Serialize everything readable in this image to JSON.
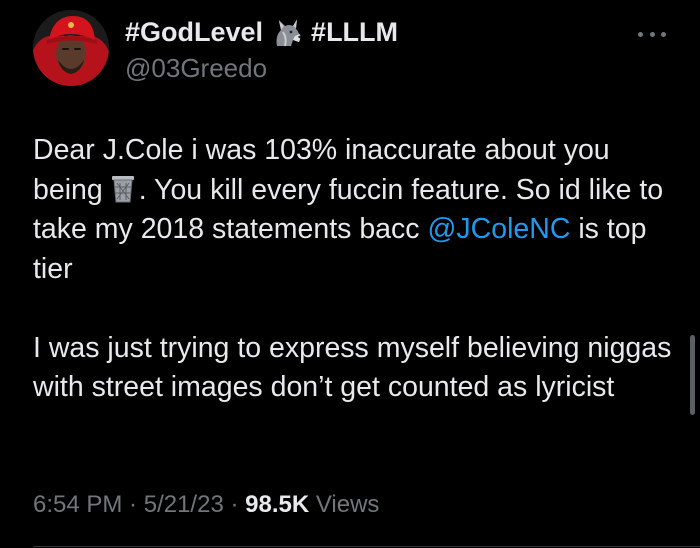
{
  "author": {
    "name_part1": "#GodLevel",
    "name_emoji": "wolf-emoji",
    "name_part2": "#LLLM",
    "handle": "@03Greedo",
    "avatar_description": "profile-photo"
  },
  "tweet": {
    "paragraph1": {
      "text_a": "Dear J.Cole i was 103% inaccurate about you being",
      "emoji": "wastebasket-emoji",
      "text_b": ". You kill every fuccin feature. So id like to take my 2018 statements bacc",
      "mention": "@JColeNC",
      "text_c": " is top tier"
    },
    "paragraph2": "I was just trying to express myself believing niggas with street images don’t get counted as lyricist"
  },
  "meta": {
    "time": "6:54 PM",
    "sep1": " · ",
    "date": "5/21/23",
    "sep2": " · ",
    "views_count": "98.5K",
    "views_label": " Views"
  },
  "icons": {
    "more": "more-horizontal-icon"
  },
  "colors": {
    "background": "#000000",
    "text": "#e7e9ea",
    "secondary": "#71767b",
    "link": "#1d9bf0",
    "avatar_cap": "#d4141c"
  }
}
